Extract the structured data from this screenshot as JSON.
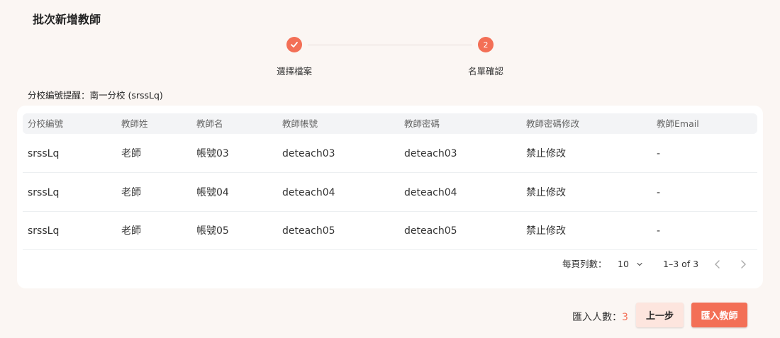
{
  "page_title": "批次新增教師",
  "stepper": {
    "steps": [
      {
        "label": "選擇檔案",
        "status": "done",
        "icon": "check-icon"
      },
      {
        "label": "名單確認",
        "status": "active",
        "number": "2"
      }
    ]
  },
  "notice": "分校編號提醒：南一分校 (srssLq)",
  "table": {
    "columns": [
      "分校編號",
      "教師姓",
      "教師名",
      "教師帳號",
      "教師密碼",
      "教師密碼修改",
      "教師Email"
    ],
    "rows": [
      [
        "srssLq",
        "老師",
        "帳號03",
        "deteach03",
        "deteach03",
        "禁止修改",
        "-"
      ],
      [
        "srssLq",
        "老師",
        "帳號04",
        "deteach04",
        "deteach04",
        "禁止修改",
        "-"
      ],
      [
        "srssLq",
        "老師",
        "帳號05",
        "deteach05",
        "deteach05",
        "禁止修改",
        "-"
      ]
    ]
  },
  "pagination": {
    "rows_per_page_label": "每頁列數：",
    "rows_per_page_value": "10",
    "range": "1–3 of 3"
  },
  "footer": {
    "import_count_label": "匯入人數：",
    "import_count_value": "3",
    "prev_button": "上一步",
    "import_button": "匯入教師"
  },
  "colors": {
    "accent": "#f36f56",
    "background": "#fbf6f3",
    "secondary_button": "#fde5de"
  }
}
